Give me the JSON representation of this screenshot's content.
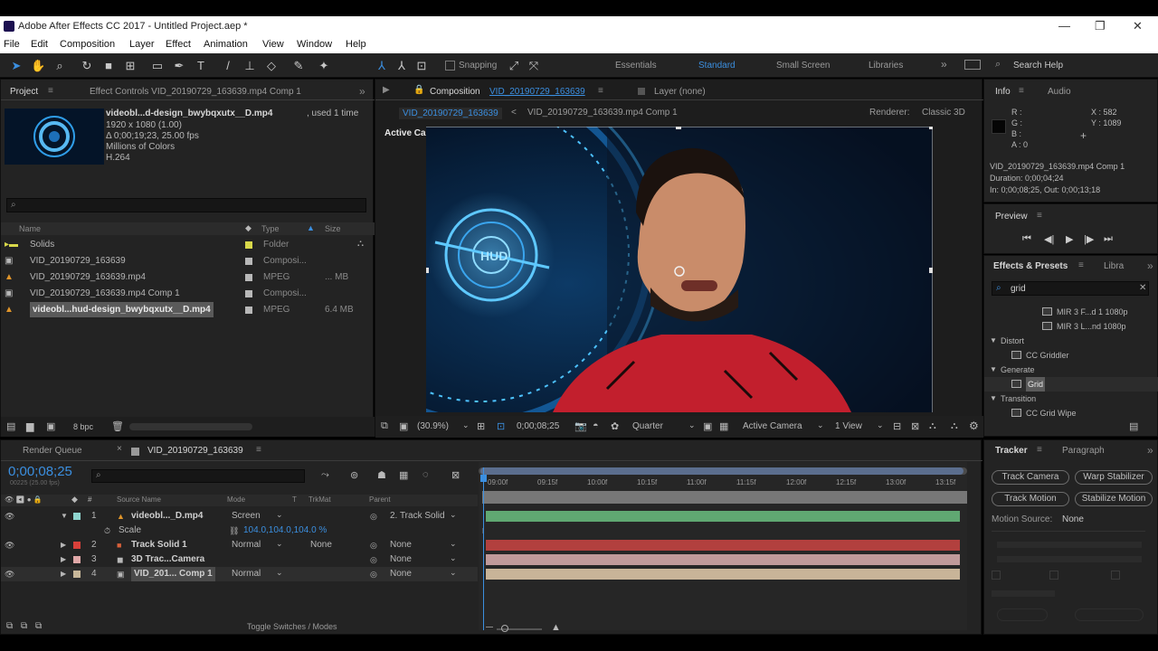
{
  "window": {
    "title": "Adobe After Effects CC 2017 - Untitled Project.aep *"
  },
  "menu": [
    "File",
    "Edit",
    "Composition",
    "Layer",
    "Effect",
    "Animation",
    "View",
    "Window",
    "Help"
  ],
  "toolbar": {
    "snapping": "Snapping",
    "workspaces": [
      "Essentials",
      "Standard",
      "Small Screen",
      "Libraries"
    ],
    "search_help": "Search Help"
  },
  "project": {
    "tab": "Project",
    "effect_controls_tab": "Effect Controls VID_20190729_163639.mp4 Comp 1",
    "preview_name": "videobl...d-design_bwybqxutx__D.mp4",
    "used": ", used 1 time",
    "info_lines": [
      "1920 x 1080 (1.00)",
      "Δ 0;00;19;23, 25.00 fps",
      "Millions of Colors",
      "H.264"
    ],
    "search_placeholder": "",
    "columns": {
      "name": "Name",
      "type": "Type",
      "size": "Size"
    },
    "items": [
      {
        "name": "Solids",
        "type": "Folder",
        "size": "",
        "color": "#d8d84a"
      },
      {
        "name": "VID_20190729_163639",
        "type": "Composi...",
        "size": "",
        "color": "#b8b8b8"
      },
      {
        "name": "VID_20190729_163639.mp4",
        "type": "MPEG",
        "size": "... MB",
        "color": "#b8b8b8"
      },
      {
        "name": "VID_20190729_163639.mp4 Comp 1",
        "type": "Composi...",
        "size": "",
        "color": "#b8b8b8"
      },
      {
        "name": "videobl...hud-design_bwybqxutx__D.mp4",
        "type": "MPEG",
        "size": "6.4 MB",
        "color": "#b8b8b8"
      }
    ],
    "bpc": "8 bpc"
  },
  "composition": {
    "tab": "Composition",
    "tab_name": "VID_20190729_163639",
    "layer_tab": "Layer (none)",
    "crumbs": [
      "VID_20190729_163639",
      "VID_20190729_163639.mp4 Comp 1"
    ],
    "renderer_label": "Renderer:",
    "renderer": "Classic 3D",
    "active_camera": "Active Camera",
    "hud_label": "HUD",
    "zoom": "(30.9%)",
    "timecode": "0;00;08;25",
    "resolution": "Quarter",
    "camera_view": "Active Camera",
    "views": "1 View"
  },
  "info": {
    "tab": "Info",
    "audio_tab": "Audio",
    "rgba": [
      "R :",
      "G :",
      "B :",
      "A : 0"
    ],
    "coords": [
      "X : 582",
      "Y : 1089"
    ],
    "details": [
      "VID_20190729_163639.mp4 Comp 1",
      "Duration: 0;00;04;24",
      "In: 0;00;08;25, Out: 0;00;13;18"
    ],
    "preview_tab": "Preview"
  },
  "effects": {
    "tab": "Effects & Presets",
    "libra_tab": "Libra",
    "search": "grid",
    "items": [
      {
        "label": "MIR 3 F...d 1 1080p",
        "indent": 2,
        "kind": "file"
      },
      {
        "label": "MIR 3 L...nd 1080p",
        "indent": 2,
        "kind": "file"
      },
      {
        "label": "Distort",
        "indent": 0,
        "kind": "cat"
      },
      {
        "label": "CC Griddler",
        "indent": 1,
        "kind": "fx"
      },
      {
        "label": "Generate",
        "indent": 0,
        "kind": "cat"
      },
      {
        "label": "Grid",
        "indent": 1,
        "kind": "fx",
        "selected": true
      },
      {
        "label": "Transition",
        "indent": 0,
        "kind": "cat"
      },
      {
        "label": "CC Grid Wipe",
        "indent": 1,
        "kind": "fx"
      }
    ]
  },
  "timeline": {
    "render_queue_tab": "Render Queue",
    "comp_tab": "VID_20190729_163639",
    "timecode": "0;00;08;25",
    "timecode_sub": "00225 (25.00 fps)",
    "columns": {
      "source": "Source Name",
      "mode": "Mode",
      "t": "T",
      "trkmat": "TrkMat",
      "parent": "Parent"
    },
    "ruler": [
      "09:00f",
      "09:15f",
      "10:00f",
      "10:15f",
      "11:00f",
      "11:15f",
      "12:00f",
      "12:15f",
      "13:00f",
      "13:15f"
    ],
    "layers": [
      {
        "num": "1",
        "name": "videobl..._D.mp4",
        "mode": "Screen",
        "trkmat": "",
        "parent": "2. Track Solid",
        "color": "#8fd5cf",
        "bar": "#60a872"
      },
      {
        "num": "2",
        "name": "Track Solid 1",
        "mode": "Normal",
        "trkmat": "None",
        "parent": "None",
        "color": "#d8403a",
        "bar": "#b2403e"
      },
      {
        "num": "3",
        "name": "3D Trac...Camera",
        "mode": "",
        "trkmat": "",
        "parent": "None",
        "color": "#e0a8a8",
        "bar": "#c09a9a"
      },
      {
        "num": "4",
        "name": "VID_201... Comp 1",
        "mode": "Normal",
        "trkmat": "",
        "parent": "None",
        "color": "#c8b89a",
        "bar": "#c8b498"
      }
    ],
    "scale_label": "Scale",
    "scale_value": "104.0,104.0,104.0 %",
    "toggle": "Toggle Switches / Modes"
  },
  "tracker": {
    "tab": "Tracker",
    "paragraph_tab": "Paragraph",
    "buttons": [
      "Track Camera",
      "Warp Stabilizer",
      "Track Motion",
      "Stabilize Motion"
    ],
    "motion_source_label": "Motion Source:",
    "motion_source": "None"
  }
}
